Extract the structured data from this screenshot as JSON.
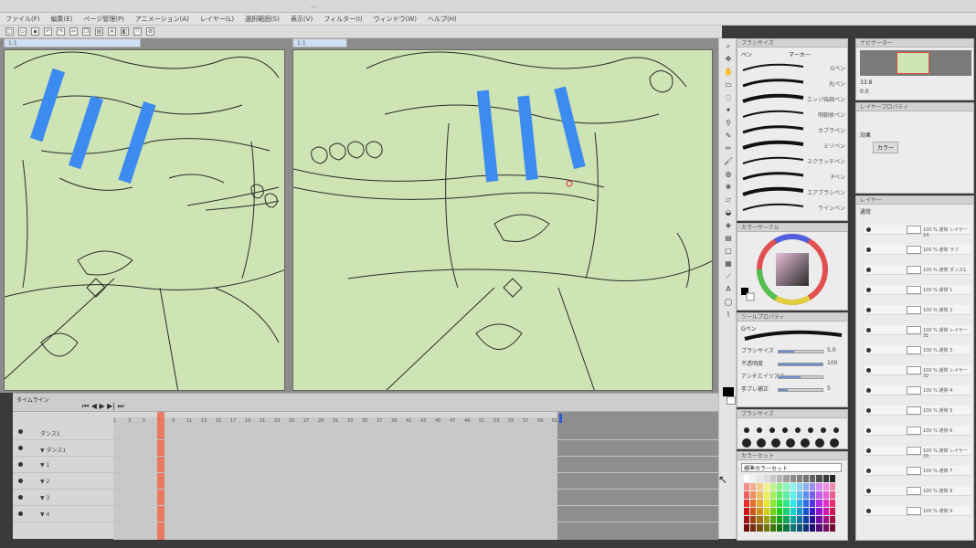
{
  "app": {
    "title": "...",
    "menu": [
      "ファイル(F)",
      "編集(E)",
      "ページ管理(P)",
      "アニメーション(A)",
      "レイヤー(L)",
      "選択範囲(S)",
      "表示(V)",
      "フィルター(I)",
      "ウィンドウ(W)",
      "ヘルプ(H)"
    ]
  },
  "canvas": {
    "tab_left": "1:1",
    "tab_right": "1:1"
  },
  "brush_panel": {
    "header": "ブラシサイズ",
    "tab_pen": "ペン",
    "tab_marker": "マーカー",
    "brushes": [
      "Gペン",
      "丸ペン",
      "エッジ強調ペン",
      "明朝体ペン",
      "カブラペン",
      "ミリペン",
      "スクラッチペン",
      "Pペン",
      "エアブラシペン",
      "ラインペン"
    ]
  },
  "color_panel": {
    "header": "カラーサークル"
  },
  "tool_property": {
    "header": "ツールプロパティ",
    "label": "Gペン",
    "rows": [
      {
        "label": "ブラシサイズ",
        "value": "5.0",
        "fill": 0.35
      },
      {
        "label": "不透明度",
        "value": "100",
        "fill": 1.0
      },
      {
        "label": "アンチエイリアス",
        "value": "",
        "fill": 0.5
      },
      {
        "label": "手ブレ補正",
        "value": "5",
        "fill": 0.2
      }
    ]
  },
  "brush_size_panel": {
    "header": "ブラシサイズ"
  },
  "color_set": {
    "header": "カラーセット",
    "preset": "標準カラーセット"
  },
  "navigator": {
    "header": "ナビゲーター",
    "zoom": "33.8",
    "rotate": "0.0"
  },
  "layer_property": {
    "header": "レイヤープロパティ",
    "effect": "効果",
    "color_label": "カラー"
  },
  "layers": {
    "header": "レイヤー",
    "blend": "通常",
    "items": [
      "100 % 通常  レイヤー 14",
      "100 % 通常  ラフ",
      "100 % 通常  ダンス1",
      "100 % 通常  1",
      "100 % 通常  2",
      "100 % 通常  レイヤー 31",
      "100 % 通常  3",
      "100 % 通常  レイヤー 32",
      "100 % 通常  4",
      "100 % 通常  5",
      "100 % 通常  6",
      "100 % 通常  レイヤー 33",
      "100 % 通常  7",
      "100 % 通常  8",
      "100 % 通常  9"
    ]
  },
  "timeline": {
    "header": "タイムライン",
    "tracks": [
      "ダンス1",
      "▼ ダンス1",
      "▼ 1",
      "▼ 2",
      "▼ 3",
      "▼ 4"
    ],
    "ruler": [
      "1",
      "3",
      "5",
      "7",
      "9",
      "11",
      "13",
      "15",
      "17",
      "19",
      "21",
      "23",
      "25",
      "27",
      "29",
      "31",
      "33",
      "35",
      "37",
      "39",
      "41",
      "43",
      "45",
      "47",
      "49",
      "51",
      "53",
      "55",
      "57",
      "59",
      "61"
    ]
  }
}
